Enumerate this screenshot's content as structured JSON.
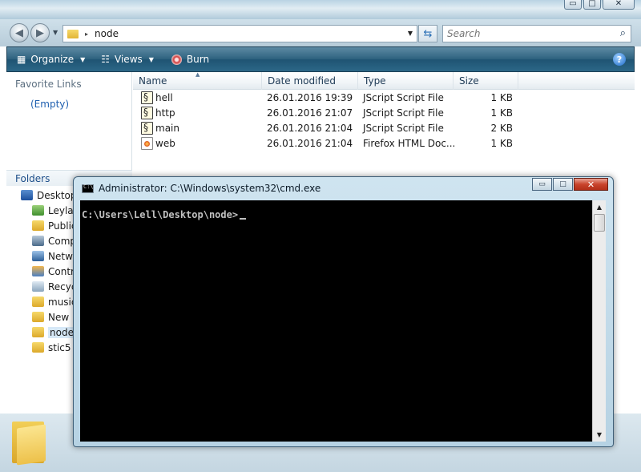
{
  "explorer": {
    "window_buttons": {
      "minimize": "▭",
      "maximize": "□",
      "close": "✕"
    },
    "address": {
      "path_segment": "node",
      "separator": "▸"
    },
    "search": {
      "placeholder": "Search"
    },
    "toolbar": {
      "organize_label": "Organize",
      "views_label": "Views",
      "burn_label": "Burn",
      "help_label": "?"
    },
    "nav": {
      "favorite_links_header": "Favorite Links",
      "favorite_links_empty": "(Empty)",
      "folders_header": "Folders",
      "tree": [
        {
          "label": "Desktop",
          "icon": "desktop-icon"
        },
        {
          "label": "Leyla",
          "icon": "user-folder-icon"
        },
        {
          "label": "Public",
          "icon": "folder-icon"
        },
        {
          "label": "Comp",
          "icon": "computer-icon"
        },
        {
          "label": "Netwo",
          "icon": "network-icon"
        },
        {
          "label": "Contro",
          "icon": "control-panel-icon"
        },
        {
          "label": "Recyc",
          "icon": "recycle-bin-icon"
        },
        {
          "label": "music",
          "icon": "folder-icon"
        },
        {
          "label": "New F",
          "icon": "folder-icon"
        },
        {
          "label": "node",
          "icon": "folder-icon",
          "selected": true
        },
        {
          "label": "stic5",
          "icon": "folder-icon"
        }
      ]
    },
    "columns": {
      "name": "Name",
      "date_modified": "Date modified",
      "type": "Type",
      "size": "Size"
    },
    "files": [
      {
        "name": "hell",
        "date": "26.01.2016 19:39",
        "type": "JScript Script File",
        "size": "1 KB",
        "icon": "jscript-file-icon"
      },
      {
        "name": "http",
        "date": "26.01.2016 21:07",
        "type": "JScript Script File",
        "size": "1 KB",
        "icon": "jscript-file-icon"
      },
      {
        "name": "main",
        "date": "26.01.2016 21:04",
        "type": "JScript Script File",
        "size": "2 KB",
        "icon": "jscript-file-icon"
      },
      {
        "name": "web",
        "date": "26.01.2016 21:04",
        "type": "Firefox HTML Doc...",
        "size": "1 KB",
        "icon": "firefox-html-file-icon"
      }
    ]
  },
  "cmd": {
    "title": "Administrator: C:\\Windows\\system32\\cmd.exe",
    "prompt": "C:\\Users\\Lell\\Desktop\\node>",
    "buttons": {
      "minimize": "▭",
      "maximize": "□",
      "close": "✕"
    }
  }
}
